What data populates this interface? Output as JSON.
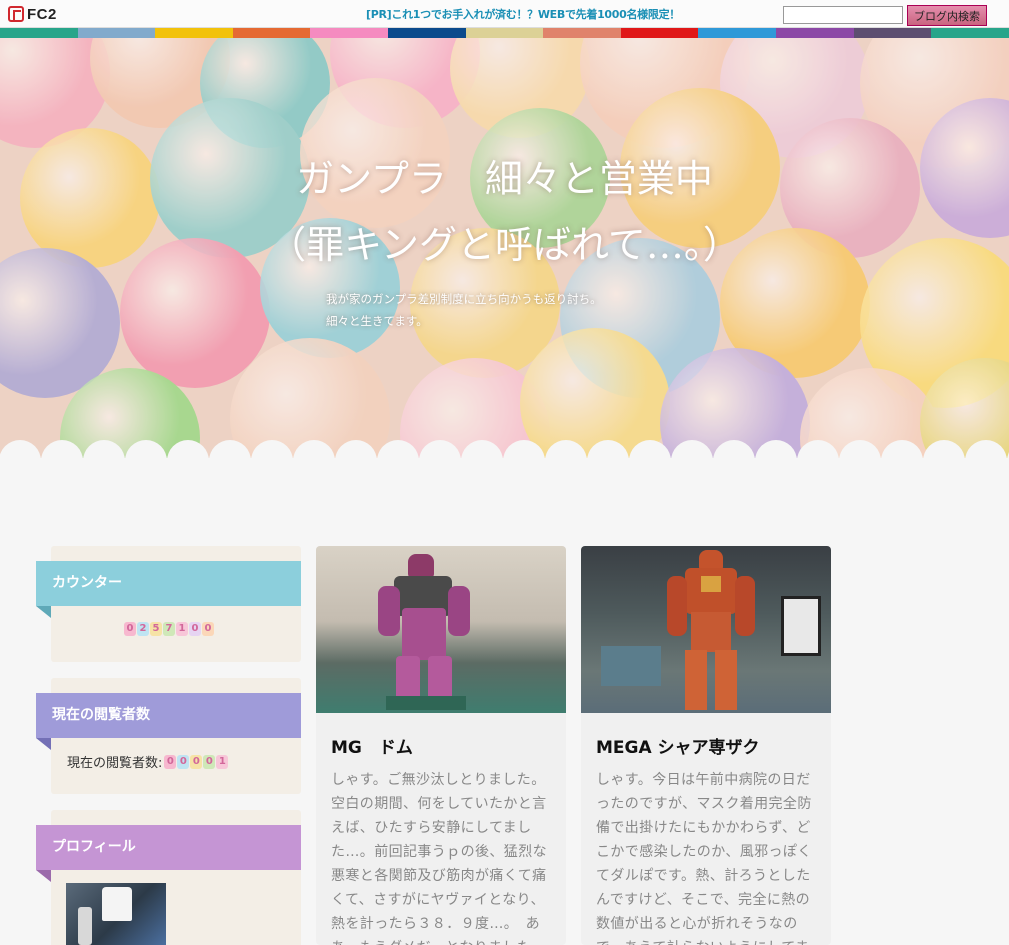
{
  "topbar": {
    "logo": "FC2",
    "pr_link": "[PR]これ1つでお手入れが済む！？WEBで先着1000名様限定！",
    "search_value": "",
    "search_button": "ブログ内検索"
  },
  "stripe_colors": [
    "#28a58a",
    "#82aacc",
    "#f2c20b",
    "#e56a33",
    "#f58bc0",
    "#0b4a8c",
    "#dcd196",
    "#e0836b",
    "#e01818",
    "#2f99d8",
    "#8c48a6",
    "#5d4e70",
    "#28a58a"
  ],
  "blog": {
    "title": "ガンプラ　細々と営業中\n（罪キングと呼ばれて…。）",
    "description": "我が家のガンプラ差別制度に立ち向かうも返り討ち。\n細々と生きてます。"
  },
  "sidebar": {
    "counter": {
      "title": "カウンター",
      "color": "#8ccfdc",
      "digits": [
        "0",
        "2",
        "5",
        "7",
        "1",
        "0",
        "0"
      ]
    },
    "viewers": {
      "title": "現在の閲覧者数",
      "color": "#9f9bd9",
      "label": "現在の閲覧者数:",
      "digits": [
        "0",
        "0",
        "0",
        "0",
        "1"
      ]
    },
    "profile": {
      "title": "プロフィール",
      "color": "#c595d4"
    }
  },
  "articles": [
    {
      "title": "MG　ドム",
      "excerpt": "しゃす。ご無沙汰しとりました。空白の期間、何をしていたかと言えば、ひたすら安静にしてました…。前回記事うｐの後、猛烈な悪寒と各関節及び筋肉が痛くて痛くて、さすがにヤヴァイとなり、熱を計ったら３８．９度…。　ああ、もうダメだ…となりました。"
    },
    {
      "title": "MEGA シャア専ザク",
      "excerpt": "しゃす。今日は午前中病院の日だったのですが、マスク着用完全防備で出掛けたにもかかわらず、どこかで感染したのか、風邪っぽくてダルぽです。熱、計ろうとしたんですけど、そこで、完全に熱の数値が出ると心が折れそうなので、あえて計らないようにしてま"
    }
  ]
}
